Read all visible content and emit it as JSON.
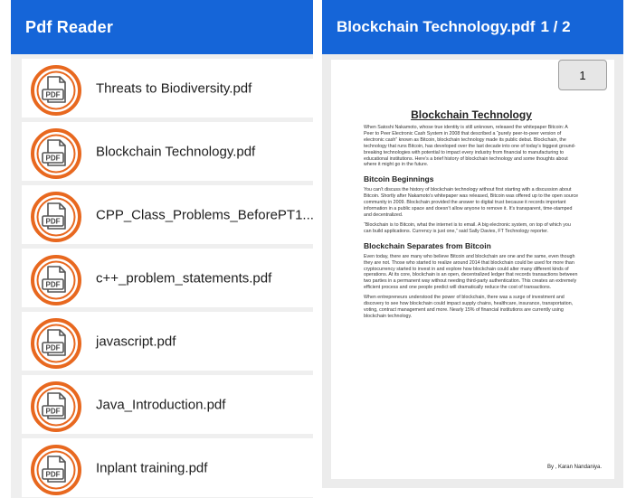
{
  "left": {
    "title": "Pdf Reader",
    "files": [
      {
        "name": "Threats to Biodiversity.pdf"
      },
      {
        "name": "Blockchain Technology.pdf"
      },
      {
        "name": "CPP_Class_Problems_BeforePT1...."
      },
      {
        "name": "c++_problem_statements.pdf"
      },
      {
        "name": "javascript.pdf"
      },
      {
        "name": "Java_Introduction.pdf"
      },
      {
        "name": "Inplant training.pdf"
      }
    ],
    "icon_label": "PDF",
    "icon_name": "pdf-file-icon"
  },
  "right": {
    "title": "Blockchain Technology.pdf",
    "page_indicator": "1 / 2",
    "page_badge": "1",
    "doc": {
      "title": "Blockchain Technology",
      "intro": "When Satoshi Nakamoto, whose true identity is still unknown, released the whitepaper Bitcoin: A Peer to Peer Electronic Cash System in 2008 that described a “purely peer-to-peer version of electronic cash” known as Bitcoin, blockchain technology made its public debut. Blockchain, the technology that runs Bitcoin, has developed over the last decade into one of today’s biggest ground-breaking technologies with potential to impact every industry from financial to manufacturing to educational institutions. Here’s a brief history of blockchain technology and some thoughts about where it might go in the future.",
      "h_beginnings": "Bitcoin Beginnings",
      "p_beginnings_1": "You can’t discuss the history of blockchain technology without first starting with a discussion about Bitcoin. Shortly after Nakamoto’s whitepaper was released, Bitcoin was offered up to the open source community in 2009. Blockchain provided the answer to digital trust because it records important information in a public space and doesn’t allow anyone to remove it. It’s transparent, time-stamped and decentralized.",
      "p_beginnings_2": "“Blockchain is to Bitcoin, what the internet is to email. A big electronic system, on top of which you can build applications. Currency is just one,” said Sally Davies, FT Technology reporter.",
      "h_separates": "Blockchain Separates from Bitcoin",
      "p_separates_1": "Even today, there are many who believe Bitcoin and blockchain are one and the same, even though they are not. Those who started to realize around 2014 that blockchain could be used for more than cryptocurrency started to invest in and explore how blockchain could alter many different kinds of operations. At its core, blockchain is an open, decentralized ledger that records transactions between two parties in a permanent way without needing third-party authentication. This creates an extremely efficient process and one people predict will dramatically reduce the cost of transactions.",
      "p_separates_2": "When entrepreneurs understood the power of blockchain, there was a surge of investment and discovery to see how blockchain could impact supply chains, healthcare, insurance, transportation, voting, contract management and more. Nearly 15% of financial institutions are currently using blockchain technology.",
      "author": "By , Karan Nandaniya."
    }
  },
  "colors": {
    "header_blue": "#1565d8",
    "icon_orange": "#e8681f"
  }
}
